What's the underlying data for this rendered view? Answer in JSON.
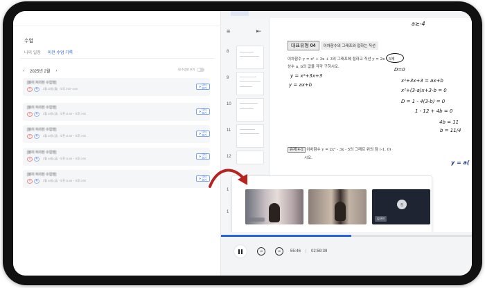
{
  "left": {
    "section_title": "수업",
    "tabs": [
      {
        "label": "나의 일정",
        "active": false
      },
      {
        "label": "이전 수업 기록",
        "active": true
      }
    ],
    "month": "2025년 2월",
    "toggle_label": "내 수업만 보기",
    "cards": [
      {
        "title": "[블러 처리된 수업명]",
        "badges": [
          "선",
          "학"
        ],
        "meta": "2월 10일 (월) · 오후 2:00~3:00",
        "button": "다시보기"
      },
      {
        "title": "[블러 처리된 수업명]",
        "badges": [
          "선",
          "학"
        ],
        "meta": "2월 14일 (금) · 오전 11:00 ~ 오후 2:00",
        "button": "다시보기"
      },
      {
        "title": "[블러 처리된 수업명]",
        "badges": [
          "선",
          "학"
        ],
        "meta": "2월 14일 (금) · 오전 11:00 ~ 오후 2:00",
        "button": "다시보기"
      },
      {
        "title": "[블러 처리된 수업명]",
        "badges": [
          "선",
          "학"
        ],
        "meta": "2월 14일 (금) · 오전 11:00 ~ 오후 2:00",
        "button": "다시보기"
      },
      {
        "title": "[블러 처리된 수업명]",
        "badges": [
          "선",
          "학"
        ],
        "meta": "2월 14일 (금) · 오전 11:00 ~ 오후 2:00",
        "button": "다시보기"
      }
    ]
  },
  "viewer": {
    "menu_icon": "hamburger-icon",
    "collapse_icon": "collapse-left-icon",
    "pages": [
      "8",
      "9",
      "10",
      "11",
      "12",
      "1",
      "1"
    ],
    "doc": {
      "top_note": "a≥-4",
      "question_tag": "대표유형",
      "question_num": "04",
      "question_title": "이차함수의 그래프와 접하는 직선",
      "problem_line1": "이차함수 y = x² + 3x + 3의 그래프에 접하고 직선 y = 2x - 5에",
      "problem_line2": "상수 a, b의 값을 각각 구하시오.",
      "circled_note": "접하고",
      "d_note": "D=0",
      "hw_left1": "y = x²+3x+3",
      "hw_left2": "y = ax+b",
      "hw_right1": "x²+3x+3 = ax+b",
      "hw_right2": "x²+(3-a)x+3-b = 0",
      "hw_right3": "D = 1 - 4(3-b) = 0",
      "hw_right4": "1 - 12 + 4b = 0",
      "hw_right5": "4b = 11",
      "hw_right6": "b = 11/4",
      "sub_tag": "유제 4-1",
      "sub_line1": "이차함수 y = 2x² - 3x - 5의 그래프 위의 점 (-1, 0)",
      "sub_line2": "시오.",
      "sub_hw": "y = a("
    }
  },
  "video": {
    "participant_name": "김규민",
    "avatar_initial": "김"
  },
  "player": {
    "pause_label": "pause",
    "rewind_label": "10",
    "forward_label": "10",
    "current_time": "55:46",
    "separator": "|",
    "total_time": "02:59:39",
    "progress": 0.52
  }
}
